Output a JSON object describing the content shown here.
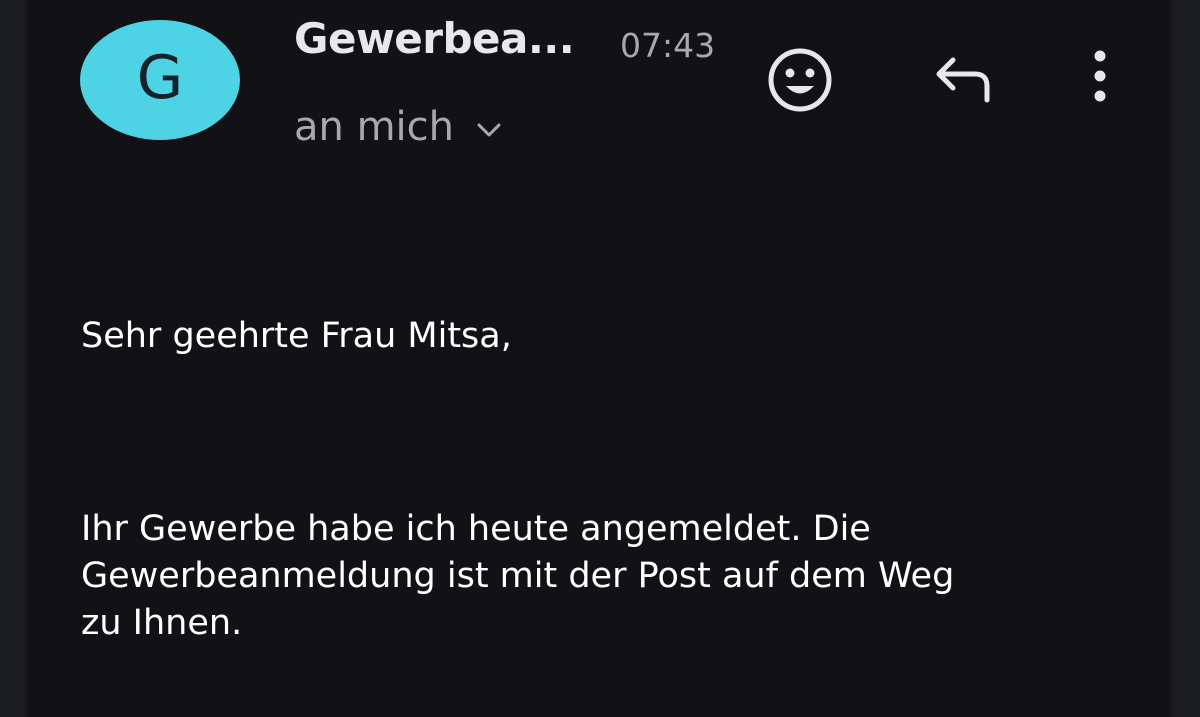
{
  "email": {
    "avatar_letter": "G",
    "sender": "Gewerbea...",
    "time": "07:43",
    "recipient": "an mich",
    "greeting": "Sehr geehrte Frau Mitsa,",
    "body_lines": [
      "Ihr Gewerbe habe ich heute angemeldet. Die",
      "Gewerbeanmeldung ist mit der Post auf dem Weg",
      "zu Ihnen."
    ]
  },
  "icons": {
    "expand": "chevron-down-icon",
    "react": "smiley-icon",
    "reply": "reply-icon",
    "more": "more-vertical-icon"
  },
  "colors": {
    "background": "#111116",
    "avatar": "#4dd3e3",
    "sender_text": "#e8e8ea",
    "secondary_text": "#a8a9ad",
    "body_text": "#ffffff"
  }
}
